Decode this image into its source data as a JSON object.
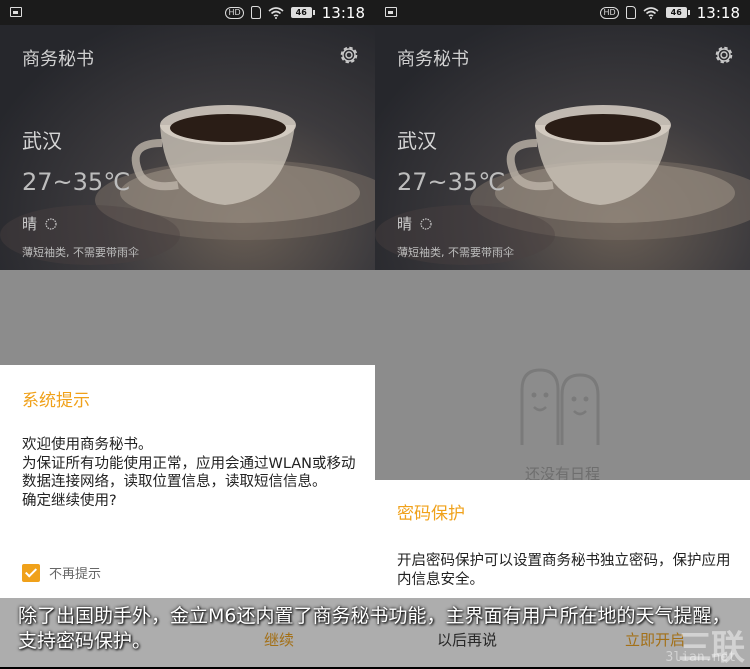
{
  "status_bar": {
    "time": "13:18",
    "network": "HD",
    "battery": "46"
  },
  "left_screen": {
    "app_title": "商务秘书",
    "city": "武汉",
    "temperature": "27~35℃",
    "condition": "晴",
    "advice": "薄短袖类, 不需要带雨伞",
    "dialog": {
      "title": "系统提示",
      "body": [
        "欢迎使用商务秘书。",
        "为保证所有功能使用正常，应用会通过WLAN或移动数据连接网络，读取位置信息，读取短信信息。",
        "确定继续使用?"
      ],
      "checkbox_label": "不再提示",
      "checkbox_checked": true,
      "cancel_label": "",
      "continue_label": "继续"
    }
  },
  "right_screen": {
    "app_title": "商务秘书",
    "city": "武汉",
    "temperature": "27~35℃",
    "condition": "晴",
    "advice": "薄短袖类, 不需要带雨伞",
    "empty_text": "还没有日程",
    "dialog": {
      "title": "密码保护",
      "body": "开启密码保护可以设置商务秘书独立密码，保护应用内信息安全。",
      "later_label": "以后再说",
      "open_label": "立即开启"
    }
  },
  "caption": "除了出国助手外，金立M6还内置了商务秘书功能，主界面有用户所在地的天气提醒，支持密码保护。",
  "watermark": {
    "main": "三联",
    "sub": "3lian.net"
  },
  "colors": {
    "accent": "#f0a11a",
    "dim": "#8c8c8c",
    "status_bar": "#1b1b1b"
  }
}
